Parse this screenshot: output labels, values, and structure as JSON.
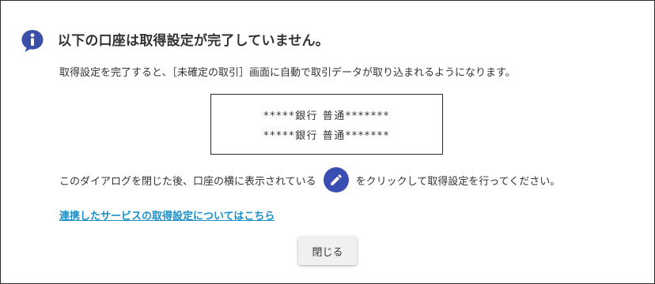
{
  "dialog": {
    "title": "以下の口座は取得設定が完了していません。",
    "description": "取得設定を完了すると、［未確定の取引］画面に自動で取引データが取り込まれるようになります。",
    "accounts": [
      "*****銀行 普通*******",
      "*****銀行 普通*******"
    ],
    "instruction_before": "このダイアログを閉じた後、口座の横に表示されている",
    "instruction_after": "をクリックして取得設定を行ってください。",
    "link_text": "連携したサービスの取得設定についてはこちら",
    "close_label": "閉じる"
  },
  "icons": {
    "info": "info-speech-bubble-icon",
    "edit": "pencil-icon"
  },
  "colors": {
    "info_icon": "#3c4fa8",
    "edit_button": "#3a4eb2",
    "link": "#1a8fc7",
    "text": "#333333",
    "button_bg": "#f0f0f0"
  }
}
